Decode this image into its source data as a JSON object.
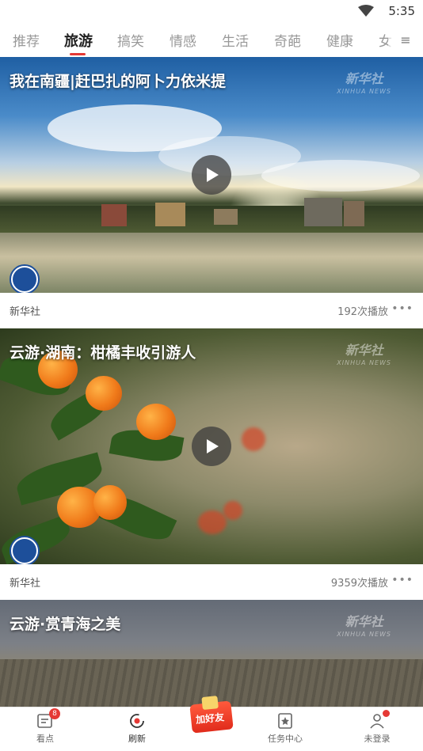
{
  "status_bar": {
    "time": "5:35"
  },
  "tabs": [
    {
      "label": "推荐",
      "active": false
    },
    {
      "label": "旅游",
      "active": true
    },
    {
      "label": "搞笑",
      "active": false
    },
    {
      "label": "情感",
      "active": false
    },
    {
      "label": "生活",
      "active": false
    },
    {
      "label": "奇葩",
      "active": false
    },
    {
      "label": "健康",
      "active": false
    },
    {
      "label": "女",
      "active": false
    }
  ],
  "menu_icon": "hamburger-icon",
  "accent_color": "#e53935",
  "feed": [
    {
      "title": "我在南疆|赶巴扎的阿卜力依米提",
      "watermark": "新华社",
      "watermark_sub": "XINHUA NEWS",
      "source": "新华社",
      "plays": "192次播放",
      "more": "•••"
    },
    {
      "title": "云游·湖南：柑橘丰收引游人",
      "watermark": "新华社",
      "watermark_sub": "XINHUA NEWS",
      "source": "新华社",
      "plays": "9359次播放",
      "more": "•••"
    },
    {
      "title": "云游·赏青海之美",
      "watermark": "新华社",
      "watermark_sub": "XINHUA NEWS"
    }
  ],
  "bottom_nav": {
    "items": [
      {
        "label": "看点",
        "icon": "news-icon",
        "badge": "8"
      },
      {
        "label": "刷新",
        "icon": "refresh-icon"
      },
      {
        "label": "加好友",
        "icon": "red-envelope-icon"
      },
      {
        "label": "任务中心",
        "icon": "star-bookmark-icon"
      },
      {
        "label": "未登录",
        "icon": "user-icon"
      }
    ]
  }
}
